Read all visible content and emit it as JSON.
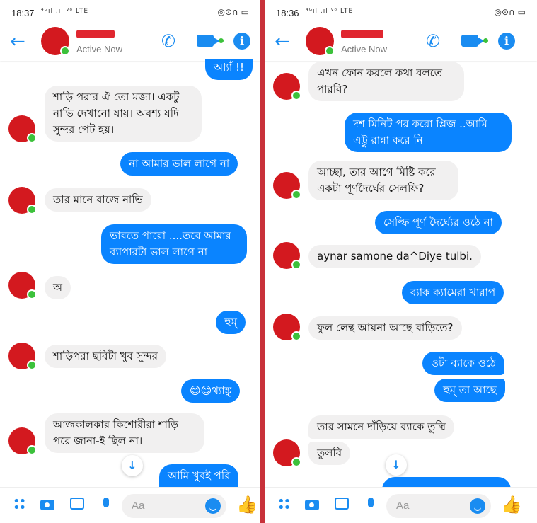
{
  "left": {
    "status": {
      "time": "18:37",
      "signal": "⁴ᴳıl .ıl ⱽᵒ LTE",
      "icons": "◎⊙∩ ▭"
    },
    "header": {
      "status": "Active Now"
    },
    "messages": [
      {
        "side": "out",
        "lines": [
          "আ্যাঁ !!"
        ]
      },
      {
        "side": "in",
        "lines": [
          "শাড়ি পরার ঐ তো মজা। একটু",
          "নাভি দেখানো যায়। অবশ্য যদি",
          "সুন্দর পেট হয়।"
        ]
      },
      {
        "side": "out",
        "lines": [
          "না আমার ভাল লাগে না"
        ]
      },
      {
        "side": "in",
        "lines": [
          "তার মানে বাজে নাভি"
        ]
      },
      {
        "side": "out",
        "lines": [
          "ভাবতে পারো ....তবে আমার",
          "ব্যাপারটা ভাল লাগে না"
        ]
      },
      {
        "side": "in",
        "lines": [
          "অ"
        ]
      },
      {
        "side": "out",
        "lines": [
          "হুম্"
        ]
      },
      {
        "side": "in",
        "lines": [
          "শাড়িপরা ছবিটা খুব সুন্দর"
        ]
      },
      {
        "side": "out",
        "lines": [
          "😊😊থ্যাঙ্কু"
        ]
      },
      {
        "side": "in",
        "lines": [
          "আজকালকার কিশোরীরা শাড়ি",
          "পরে জানা-ই ছিল না।"
        ]
      },
      {
        "side": "out",
        "lines": [
          "আমি খুবই পরি"
        ]
      }
    ],
    "composer": {
      "placeholder": "Aa"
    }
  },
  "right": {
    "status": {
      "time": "18:36",
      "signal": "⁴ᴳıl .ıl ⱽᵒ LTE",
      "icons": "◎⊙∩ ▭"
    },
    "header": {
      "status": "Active Now"
    },
    "messages": [
      {
        "side": "in",
        "lines": [
          "এখন ফোন করলে কথা বলতে",
          "পারবি?"
        ]
      },
      {
        "side": "out",
        "lines": [
          "দশ মিনিট পর করো প্লিজ ..আমি",
          "এট্টু রান্না করে নি"
        ]
      },
      {
        "side": "in",
        "lines": [
          "আচ্ছা, তার আগে মিষ্টি করে",
          "একটা পূর্ণদৈর্ঘের সেলফি?"
        ]
      },
      {
        "side": "out",
        "lines": [
          "সেল্ফি পূর্ণ দৈর্ঘ্যের ওঠে না"
        ]
      },
      {
        "side": "in",
        "lines": [
          "aynar samone da^Diye tulbi."
        ]
      },
      {
        "side": "out",
        "lines": [
          "ব্যাক ক্যামেরা খারাপ"
        ]
      },
      {
        "side": "in",
        "lines": [
          "ফুল লেন্থ আয়না আছে বাড়িতে?"
        ]
      },
      {
        "side": "out",
        "lines": [
          "ওটা ব্যাকে ওঠে"
        ]
      },
      {
        "side": "out",
        "lines": [
          "হুম্ তা আছে"
        ]
      },
      {
        "side": "in",
        "lines": [
          "তার সামনে দাঁড়িয়ে ব্যাকে তুল্বি"
        ]
      },
      {
        "side": "in",
        "lines": [
          "তুলবি"
        ]
      }
    ],
    "composer": {
      "placeholder": "Aa"
    }
  },
  "colors": {
    "accent": "#1a8cf1",
    "bubble_out": "#0a84ff",
    "bubble_in": "#f1f0f0",
    "avatar": "#d3191f",
    "online": "#3cc13b",
    "divider": "#c8313a"
  },
  "icons": [
    "back-arrow-icon",
    "phone-icon",
    "video-camera-icon",
    "info-icon",
    "apps-grid-icon",
    "camera-icon",
    "gallery-icon",
    "microphone-icon",
    "emoji-icon",
    "thumbs-up-icon",
    "scroll-down-arrow-icon"
  ]
}
